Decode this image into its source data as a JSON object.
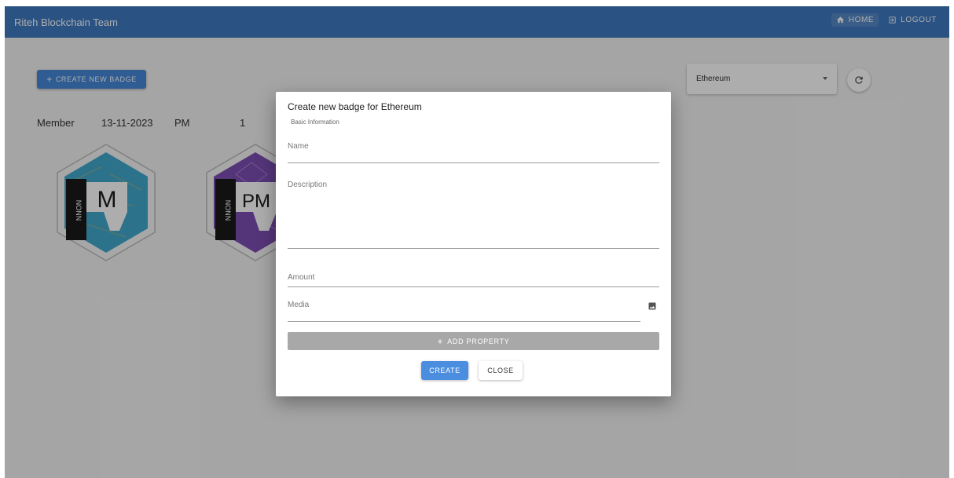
{
  "app": {
    "title": "Riteh Blockchain Team"
  },
  "nav": {
    "home_label": "HOME",
    "logout_label": "LOGOUT"
  },
  "toolbar": {
    "create_badge_label": "CREATE NEW BADGE"
  },
  "network_select": {
    "value": "Ethereum"
  },
  "badge_list": {
    "items": [
      {
        "name": "Member",
        "date": "13-11-2023",
        "badge_text": "M",
        "accent": "#42a8cc"
      },
      {
        "name": "PM",
        "date": "1",
        "badge_text": "PM",
        "accent": "#7e4eb4"
      }
    ],
    "side_text": "NONN"
  },
  "dialog": {
    "title": "Create new badge for Ethereum",
    "section": "Basic Information",
    "fields": {
      "name": "Name",
      "description": "Description",
      "amount": "Amount",
      "media": "Media"
    },
    "add_property_label": "ADD PROPERTY",
    "create_label": "CREATE",
    "close_label": "CLOSE"
  },
  "icons": {
    "home": "home-icon",
    "logout": "logout-icon",
    "plus": "plus-icon",
    "refresh": "refresh-icon",
    "caret": "caret-down-icon",
    "image": "image-icon"
  },
  "colors": {
    "topbar": "#3f79c2",
    "primary_button": "#4688d7",
    "add_property": "#a8a8a8"
  }
}
